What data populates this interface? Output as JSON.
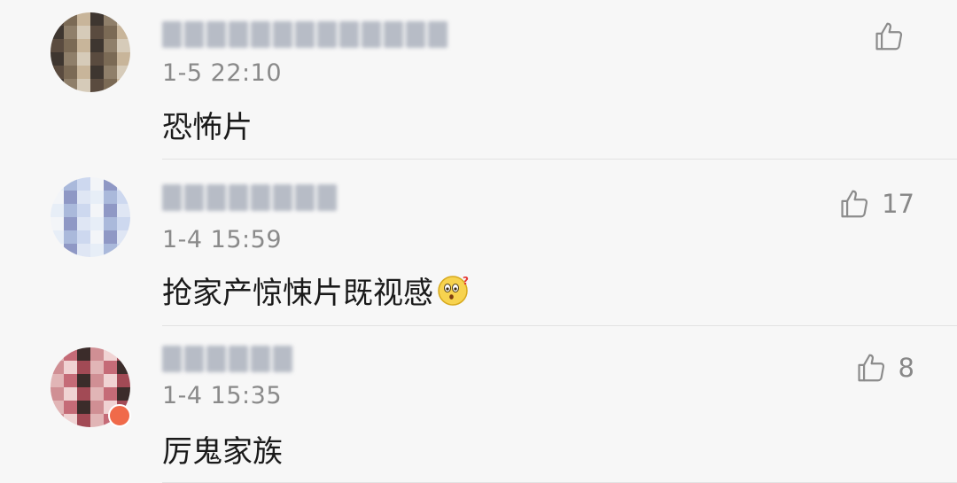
{
  "comments": [
    {
      "username": "",
      "time": "1-5 22:10",
      "text": "恐怖片",
      "likes": "",
      "avatar": {
        "colors": [
          "#5a4b3f",
          "#7b6a55",
          "#c8b59a",
          "#3e3630",
          "#8f7f6a",
          "#d6cbb9"
        ]
      }
    },
    {
      "username": "",
      "time": "1-4 15:59",
      "text": "抢家产惊悚片既视感",
      "likes": "17",
      "avatar": {
        "colors": [
          "#e7eef7",
          "#aab9db",
          "#cdd8ef",
          "#f3f5f8",
          "#8f98c5",
          "#dfe6f4"
        ]
      },
      "emoji": "surprised-face-icon"
    },
    {
      "username": "",
      "time": "1-4 15:35",
      "text": "厉鬼家族",
      "likes": "8",
      "avatar": {
        "colors": [
          "#e1b5b6",
          "#c56b77",
          "#3b2c2a",
          "#d08f94",
          "#f0d3d3",
          "#a24a55"
        ]
      },
      "badge": "vip-badge-icon"
    }
  ],
  "icons": {
    "like": "thumbs-up-icon"
  }
}
